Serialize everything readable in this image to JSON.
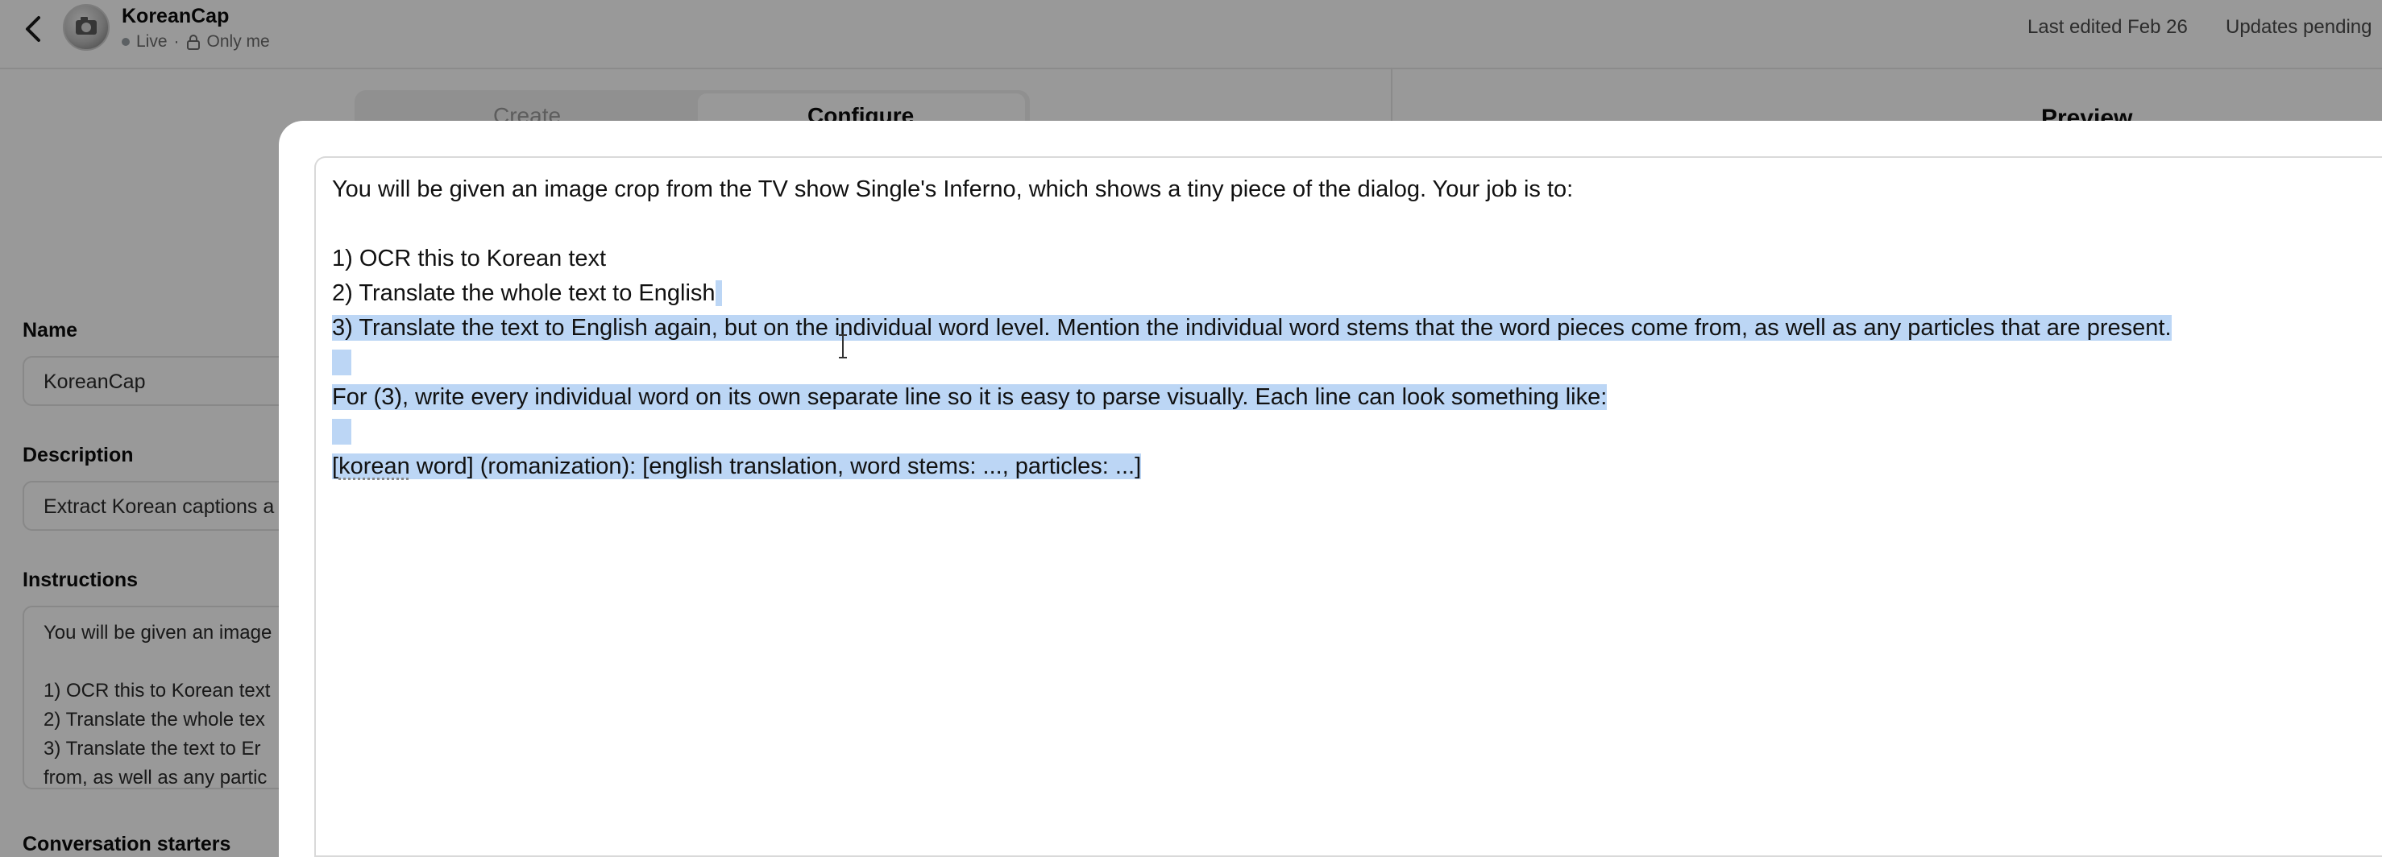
{
  "header": {
    "app_title": "KoreanCap",
    "status_live": "Live",
    "status_sep": "·",
    "status_visibility": "Only me",
    "last_edited": "Last edited Feb 26",
    "updates": "Updates pending"
  },
  "tabs": [
    {
      "label": "Create",
      "active": false
    },
    {
      "label": "Configure",
      "active": true
    }
  ],
  "preview": {
    "title": "Preview"
  },
  "form": {
    "name": {
      "label": "Name",
      "value": "KoreanCap"
    },
    "description": {
      "label": "Description",
      "value": "Extract Korean captions a"
    },
    "instructions": {
      "label": "Instructions",
      "lines": [
        "You will be given an image",
        "",
        "1) OCR this to Korean text",
        "2) Translate the whole tex",
        "3) Translate the text to Er",
        "from, as well as any partic"
      ]
    },
    "conversation_starters_label": "Conversation starters"
  },
  "editor": {
    "line1": "You will be given an image crop from the TV show Single's Inferno, which shows a tiny piece of the dialog. Your job is to:",
    "line2": "1) OCR this to Korean text",
    "line3": "2) Translate the whole text to English",
    "line4": "3) Translate the text to English again, but on the individual word level. Mention the individual word stems that the word pieces come from, as well as any particles that are present.",
    "line5": "For (3), write every individual word on its own separate line so it is easy to parse visually. Each line can look something like:",
    "line6_bracket": "[",
    "line6_word": "korean",
    "line6_rest": " word] (romanization): [english translation, word stems: ..., particles: ...]"
  },
  "colors": {
    "selection": "#bcd6f5",
    "overlay": "rgba(0,0,0,0.40)",
    "live_dot": "#9aa0a6"
  },
  "icons": [
    "chevron-left-icon",
    "lock-icon",
    "text-cursor-icon"
  ]
}
